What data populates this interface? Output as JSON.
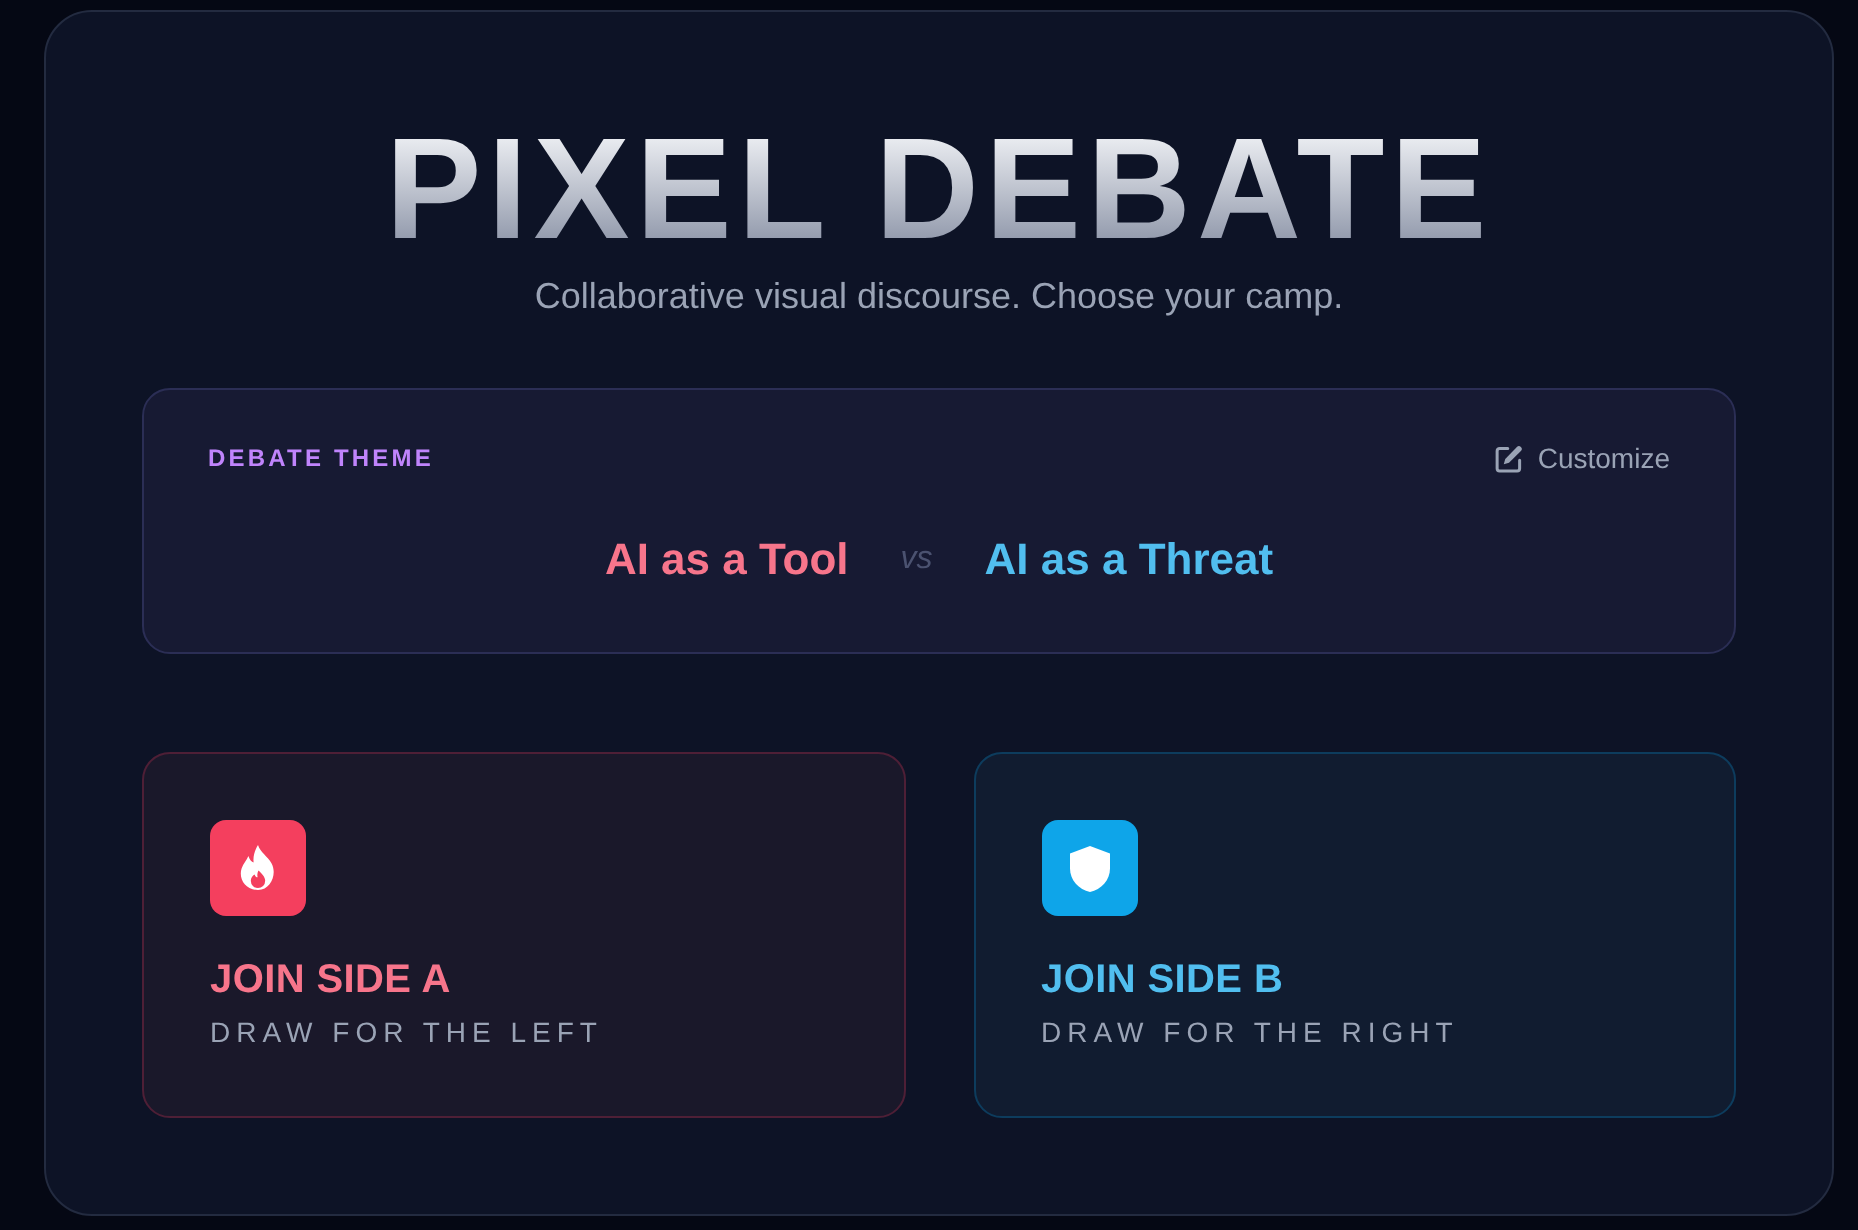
{
  "header": {
    "title": "PIXEL DEBATE",
    "subtitle": "Collaborative visual discourse. Choose your camp."
  },
  "theme": {
    "label": "DEBATE THEME",
    "action": "Customize",
    "motions": [
      "AI as a Tool",
      "AI as a Threat"
    ],
    "separator": "vs"
  },
  "sides": [
    {
      "kind": "flame",
      "color": "#f43f5e",
      "title": "JOIN SIDE A",
      "subtitle": "DRAW FOR THE LEFT"
    },
    {
      "kind": "shield",
      "color": "#0ea5e9",
      "title": "JOIN SIDE B",
      "subtitle": "DRAW FOR THE RIGHT"
    }
  ]
}
